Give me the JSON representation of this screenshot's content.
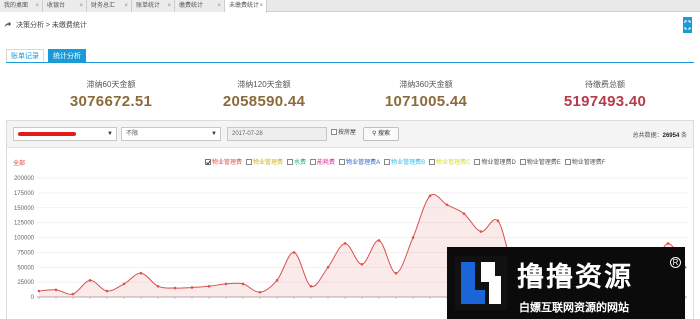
{
  "tabs": [
    {
      "label": "我的桌面",
      "left": 0,
      "width": 43
    },
    {
      "label": "收银台",
      "left": 43,
      "width": 44
    },
    {
      "label": "财务总汇",
      "left": 87,
      "width": 45
    },
    {
      "label": "账单统计",
      "left": 132,
      "width": 43
    },
    {
      "label": "缴费统计",
      "left": 175,
      "width": 50
    },
    {
      "label": "未缴费统计",
      "left": 225,
      "width": 42
    }
  ],
  "breadcrumb": "决策分析 > 未缴费统计",
  "subtabs": [
    "账单记录",
    "统计分析"
  ],
  "summary": [
    {
      "label": "滞纳60天金额",
      "value": "3076672.51",
      "color": "#8b6b3b"
    },
    {
      "label": "滞纳120天金额",
      "value": "2058590.44",
      "color": "#8b6b3b"
    },
    {
      "label": "滞纳360天金额",
      "value": "1071005.44",
      "color": "#8b6b3b"
    },
    {
      "label": "待缴费总额",
      "value": "5197493.40",
      "color": "#b73a4a"
    }
  ],
  "filter": {
    "select2": "不限",
    "date": "2017-07-28",
    "checkbox_label": "按房屋",
    "search_button": "搜索",
    "count_label": "总共数据：",
    "count_value": "26954",
    "count_unit": "条"
  },
  "legend_all": "全部",
  "legend": [
    {
      "label": "物业管理费",
      "color": "#d9534f",
      "checked": true
    },
    {
      "label": "物业管理费",
      "color": "#c9b42a",
      "checked": false
    },
    {
      "label": "水费",
      "color": "#22aa88",
      "checked": false
    },
    {
      "label": "能耗费",
      "color": "#cc3399",
      "checked": false
    },
    {
      "label": "物业管理费A",
      "color": "#3366cc",
      "checked": false
    },
    {
      "label": "物业管理费B",
      "color": "#33bbee",
      "checked": false
    },
    {
      "label": "物业管理费C",
      "color": "#dddd22",
      "checked": false
    },
    {
      "label": "物业管理费D",
      "color": "#555555",
      "checked": false
    },
    {
      "label": "物业管理费E",
      "color": "#555555",
      "checked": false
    },
    {
      "label": "物业管理费F",
      "color": "#555555",
      "checked": false
    }
  ],
  "chart_data": {
    "type": "area",
    "ylim": [
      0,
      200000
    ],
    "yticks": [
      "0",
      "25000",
      "50000",
      "75000",
      "100000",
      "125000",
      "150000",
      "175000",
      "200000"
    ],
    "series": [
      {
        "color": "#d9534f",
        "values": [
          10000,
          12000,
          5000,
          28000,
          10000,
          22000,
          40000,
          18000,
          15000,
          16000,
          18000,
          22000,
          22000,
          8000,
          28000,
          75000,
          18000,
          50000,
          90000,
          55000,
          95000,
          40000,
          100000,
          170000,
          155000,
          140000,
          110000,
          128000,
          45000,
          72000,
          68000,
          70000,
          65000,
          58000,
          52000,
          48000,
          45000,
          90000,
          50000
        ]
      }
    ]
  },
  "watermark": {
    "title": "撸撸资源",
    "subtitle": "白嫖互联网资源的网站",
    "reg": "R"
  }
}
